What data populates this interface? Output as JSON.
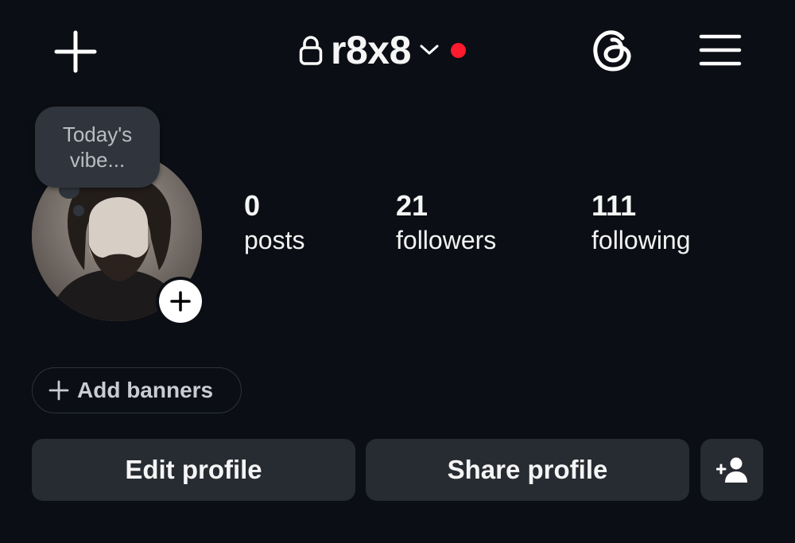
{
  "header": {
    "username": "r8x8",
    "icons": {
      "create": "plus-icon",
      "lock": "lock-icon",
      "switch_account": "chevron-down-icon",
      "threads": "threads-icon",
      "menu": "hamburger-menu-icon"
    },
    "notification_dot_color": "#ff1a2e"
  },
  "note": {
    "line1": "Today's",
    "line2": "vibe..."
  },
  "stats": {
    "posts": {
      "value": "0",
      "label": "posts"
    },
    "followers": {
      "value": "21",
      "label": "followers"
    },
    "following": {
      "value": "111",
      "label": "following"
    }
  },
  "banners": {
    "label": "Add banners"
  },
  "actions": {
    "edit": "Edit profile",
    "share": "Share profile",
    "discover_people_icon": "add-person-icon"
  },
  "colors": {
    "background": "#0b0e14",
    "button": "#272b32",
    "note_bubble": "#30353d"
  }
}
